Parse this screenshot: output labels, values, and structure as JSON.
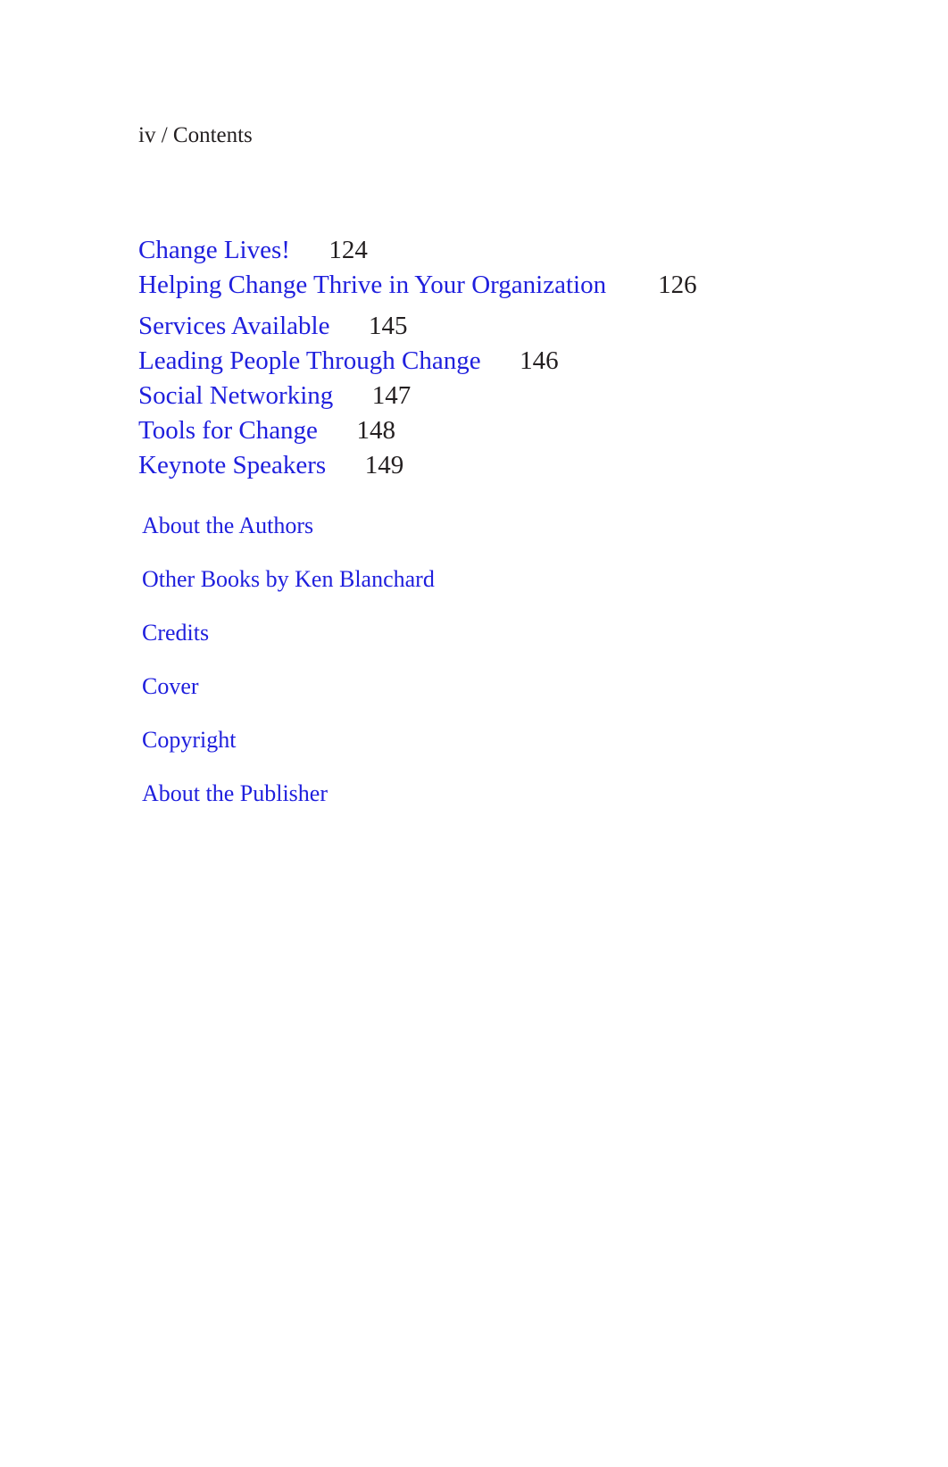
{
  "document": {
    "running_head": "iv / Contents",
    "page_background": "#ffffff",
    "link_color": "#1f1fdd",
    "text_color": "#231f20"
  },
  "toc": {
    "entries": [
      {
        "title": "Change Lives!",
        "page": "124"
      },
      {
        "title": "Helping Change Thrive in Your Organization",
        "page": "126"
      },
      {
        "title": "Services Available",
        "page": "145"
      },
      {
        "title": "Leading People Through Change",
        "page": "146"
      },
      {
        "title": "Social Networking",
        "page": "147"
      },
      {
        "title": "Tools for Change",
        "page": "148"
      },
      {
        "title": "Keynote Speakers",
        "page": "149"
      }
    ],
    "separators": {
      "gap_entry": "Helping Change Thrive in Your Organization"
    }
  },
  "backmatter": {
    "entries": [
      {
        "title": "About the Authors"
      },
      {
        "title": "Other Books by Ken Blanchard"
      },
      {
        "title": "Credits"
      },
      {
        "title": "Cover"
      },
      {
        "title": "Copyright"
      },
      {
        "title": "About the Publisher"
      }
    ]
  },
  "spacing": {
    "toc_title_page_gap": "      ",
    "toc_title_page_gap_wide": "        "
  }
}
